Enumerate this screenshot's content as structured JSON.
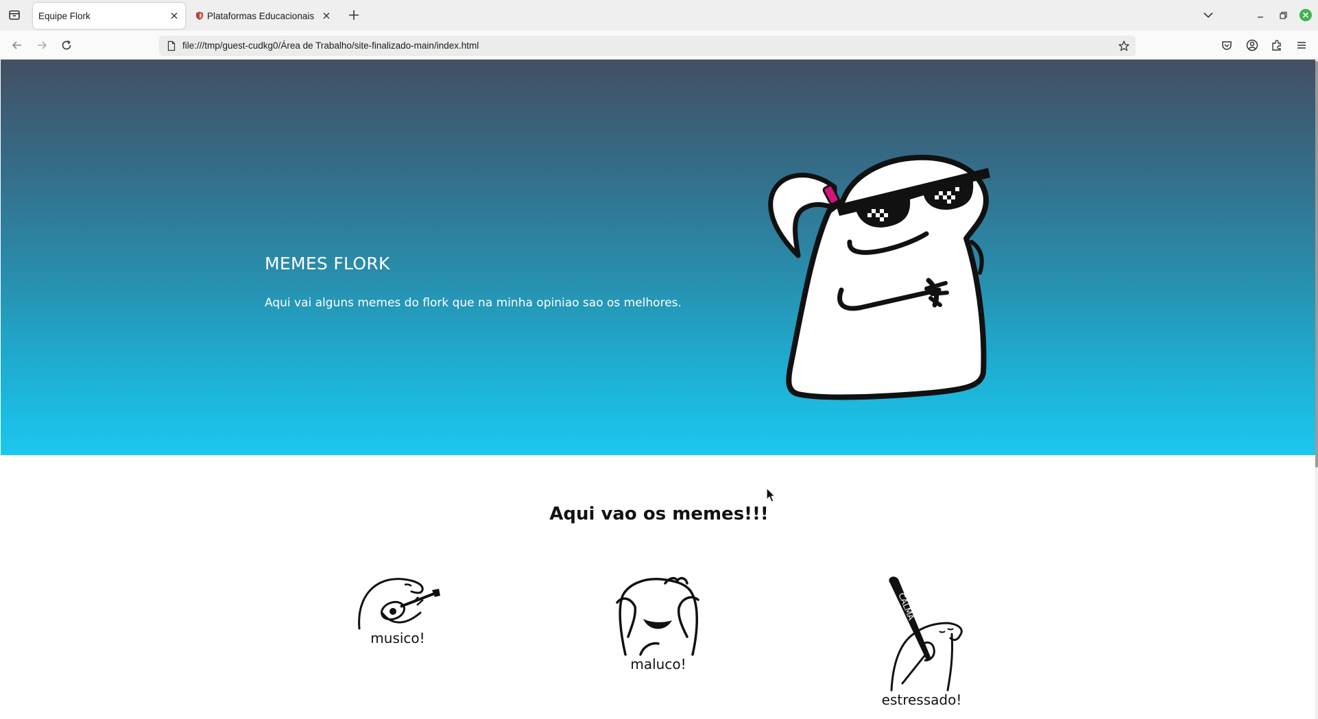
{
  "browser": {
    "tabs": [
      {
        "title": "Equipe Flork",
        "active": true
      },
      {
        "title": "Plataformas Educacionais",
        "active": false
      }
    ],
    "url": "file:///tmp/guest-cudkg0/Área de Trabalho/site-finalizado-main/index.html"
  },
  "hero": {
    "title": "MEMES FLORK",
    "text": "Aqui vai alguns memes do flork que na minha opiniao sao os melhores."
  },
  "memes": {
    "section_title": "Aqui vao os memes!!!",
    "items": [
      {
        "caption": "musico!"
      },
      {
        "caption": "maluco!"
      },
      {
        "caption": "estressado!",
        "bat_text": "CALMA"
      }
    ]
  },
  "colors": {
    "hero_top": "#444f63",
    "hero_bottom": "#1bc7ef",
    "accent_pink": "#d4147a"
  }
}
